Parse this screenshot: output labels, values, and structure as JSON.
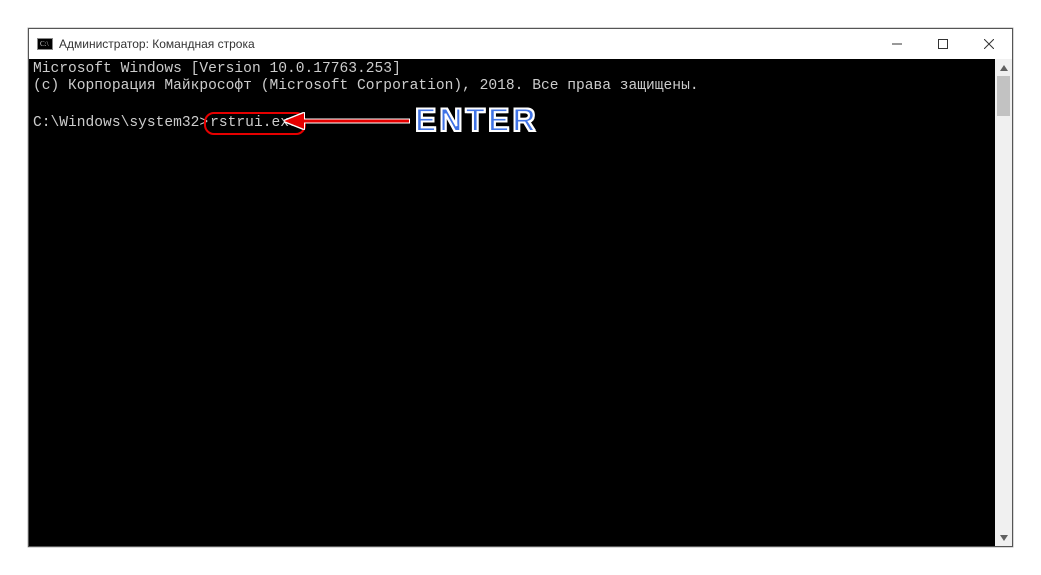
{
  "window": {
    "title": "Администратор: Командная строка"
  },
  "console": {
    "line1": "Microsoft Windows [Version 10.0.17763.253]",
    "line2": "(c) Корпорация Майкрософт (Microsoft Corporation), 2018. Все права защищены.",
    "prompt": "C:\\Windows\\system32>",
    "command": "rstrui.exe"
  },
  "annotation": {
    "label": "ENTER"
  },
  "colors": {
    "console_bg": "#000000",
    "console_fg": "#cccccc",
    "highlight_border": "#e60000",
    "arrow": "#e60000",
    "label_fill": "#4073e6",
    "label_stroke": "#ffffff"
  }
}
